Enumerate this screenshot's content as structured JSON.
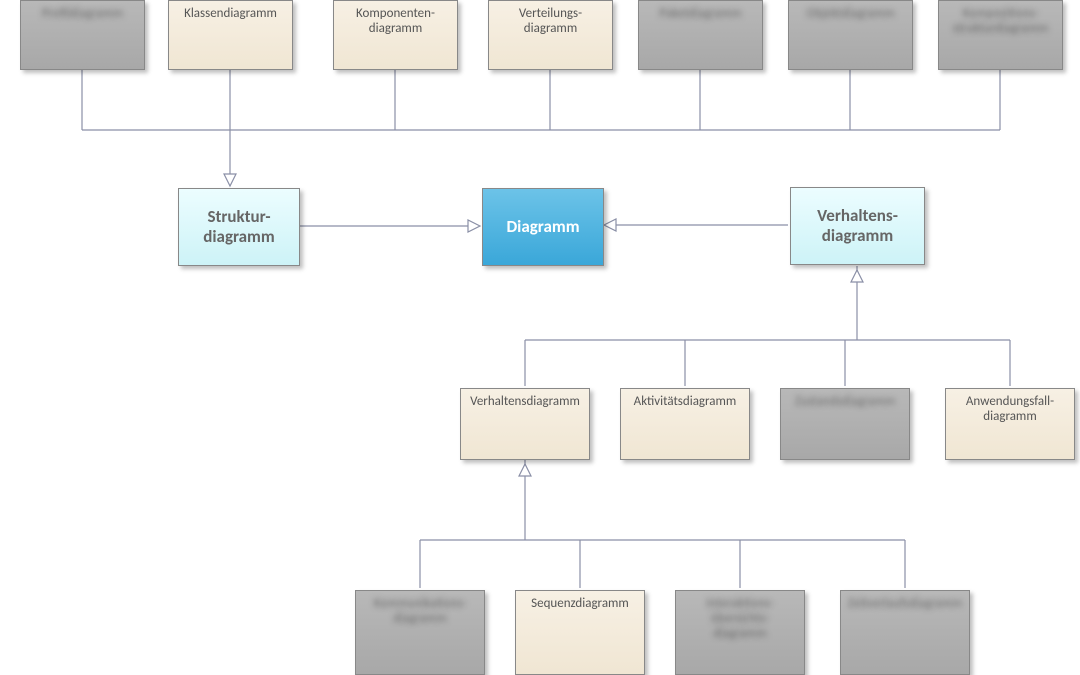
{
  "diagram_type": "UML-Diagrammhierarchie",
  "top_row": [
    {
      "label": "Profildiagramm",
      "style": "grey"
    },
    {
      "label": "Klassendiagramm",
      "style": "beige"
    },
    {
      "label": "Komponenten-\ndiagramm",
      "style": "beige"
    },
    {
      "label": "Verteilungs-\ndiagramm",
      "style": "beige"
    },
    {
      "label": "Paketdiagramm",
      "style": "grey"
    },
    {
      "label": "Objektdiagramm",
      "style": "grey"
    },
    {
      "label": "Kompositions-\nstrukturdiagramm",
      "style": "grey"
    }
  ],
  "mid_row": {
    "left": {
      "label": "Struktur-\ndiagramm",
      "style": "cyan"
    },
    "center": {
      "label": "Diagramm",
      "style": "blue"
    },
    "right": {
      "label": "Verhaltens-\ndiagramm",
      "style": "cyan"
    }
  },
  "behavior_row": [
    {
      "label": "Verhaltensdiagramm",
      "style": "beige"
    },
    {
      "label": "Aktivitätsdiagramm",
      "style": "beige"
    },
    {
      "label": "Zustandsdiagramm",
      "style": "grey"
    },
    {
      "label": "Anwendungsfall-\ndiagramm",
      "style": "beige"
    }
  ],
  "bottom_row": [
    {
      "label": "Kommunikations-\ndiagramm",
      "style": "grey"
    },
    {
      "label": "Sequenzdiagramm",
      "style": "beige"
    },
    {
      "label": "Interaktions-\nübersichts-\ndiagramm",
      "style": "grey"
    },
    {
      "label": "Zeitverlaufsdiagramm",
      "style": "grey"
    }
  ]
}
